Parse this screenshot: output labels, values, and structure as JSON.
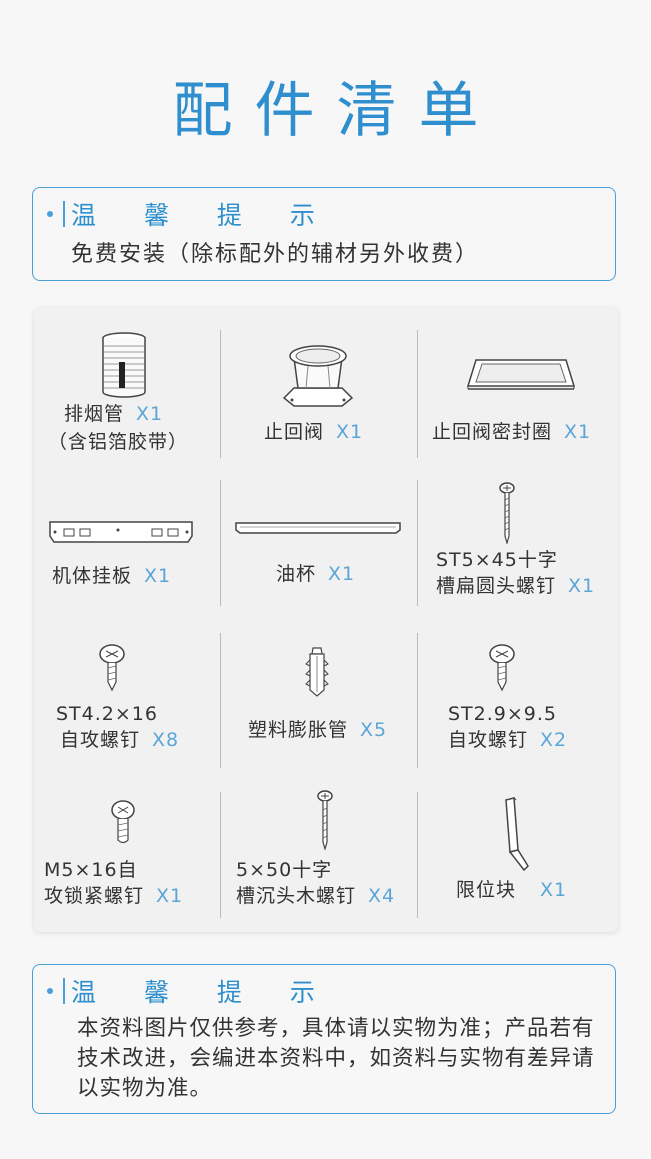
{
  "title": "配件清单",
  "tip_top": {
    "heading": "温 馨 提 示",
    "text": "免费安装（除标配外的辅材另外收费）"
  },
  "parts": [
    {
      "name": "排烟管",
      "qty": "X1",
      "note": "（含铝箔胶带）",
      "icon": "exhaust-pipe-icon"
    },
    {
      "name": "止回阀",
      "qty": "X1",
      "icon": "check-valve-icon"
    },
    {
      "name": "止回阀密封圈",
      "qty": "X1",
      "icon": "valve-seal-ring-icon"
    },
    {
      "name": "机体挂板",
      "qty": "X1",
      "icon": "mounting-plate-icon"
    },
    {
      "name": "油杯",
      "qty": "X1",
      "icon": "oil-cup-icon"
    },
    {
      "name_line1": "ST5×45十字",
      "name_line2": "槽扁圆头螺钉",
      "qty": "X1",
      "icon": "pan-head-screw-icon"
    },
    {
      "name_line1": "ST4.2×16",
      "name_line2": "自攻螺钉",
      "qty": "X8",
      "icon": "tapping-screw-icon"
    },
    {
      "name": "塑料膨胀管",
      "qty": "X5",
      "icon": "plastic-anchor-icon"
    },
    {
      "name_line1": "ST2.9×9.5",
      "name_line2": "自攻螺钉",
      "qty": "X2",
      "icon": "small-tapping-screw-icon"
    },
    {
      "name_line1": "M5×16自",
      "name_line2": "攻锁紧螺钉",
      "qty": "X1",
      "icon": "locking-screw-icon"
    },
    {
      "name_line1": "5×50十字",
      "name_line2": "槽沉头木螺钉",
      "qty": "X4",
      "icon": "wood-screw-icon"
    },
    {
      "name": "限位块",
      "qty": "X1",
      "icon": "limit-block-icon"
    }
  ],
  "tip_bottom": {
    "heading": "温 馨 提 示",
    "text": "本资料图片仅供参考，具体请以实物为准；产品若有技术改进，会编进本资料中，如资料与实物有差异请以实物为准。"
  }
}
